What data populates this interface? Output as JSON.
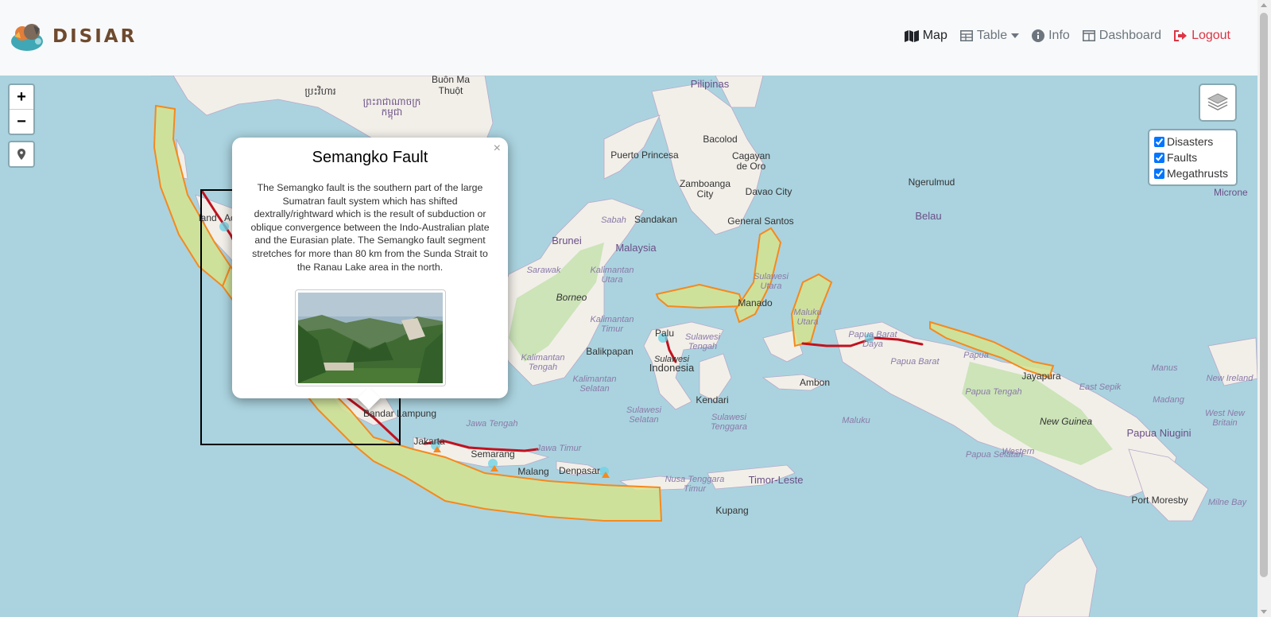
{
  "brand": {
    "name": "DISIAR"
  },
  "nav": {
    "map": "Map",
    "table": "Table",
    "info": "Info",
    "dashboard": "Dashboard",
    "logout": "Logout"
  },
  "map_controls": {
    "zoom_in": "+",
    "zoom_out": "−"
  },
  "layers": {
    "disasters": "Disasters",
    "faults": "Faults",
    "megathrusts": "Megathrusts"
  },
  "popup": {
    "close": "×",
    "title": "Semangko Fault",
    "description": "The Semangko fault is the southern part of the large Sumatran fault system which has shifted dextrally/rightward which is the result of subduction or oblique convergence between the Indo-Australian plate and the Eurasian plate. The Semangko fault segment stretches for more than 80 km from the Sunda Strait to the Ranau Lake area in the north."
  },
  "map_labels": {
    "buon_ma_thuot_1": "Buôn Ma",
    "buon_ma_thuot_2": "Thuột",
    "pilipinas": "Pilipinas",
    "preah_vihear": "ប្រះវិហារ",
    "kampuchea_1": "ព្រះរាជាណាចក្រ",
    "kampuchea_2": "កម្ពុជា",
    "puerto_princesa": "Puerto Princesa",
    "bacolod": "Bacolod",
    "cagayan_1": "Cagayan",
    "cagayan_2": "de Oro",
    "zamboanga_1": "Zamboanga",
    "zamboanga_2": "City",
    "davao": "Davao City",
    "ngerulmud": "Ngerulmud",
    "micronesia": "Microne",
    "land": "land",
    "ac": "Ac",
    "sabah": "Sabah",
    "sandakan": "Sandakan",
    "general_santos": "General Santos",
    "belau": "Belau",
    "brunei": "Brunei",
    "malaysia": "Malaysia",
    "sarawak": "Sarawak",
    "kalimantan_utara_1": "Kalimantan",
    "kalimantan_utara_2": "Utara",
    "sulawesi_utara_1": "Sulawesi",
    "sulawesi_utara_2": "Utara",
    "manado": "Manado",
    "maluku_utara_1": "Maluku",
    "maluku_utara_2": "Utara",
    "borneo": "Borneo",
    "kalimantan_timur_1": "Kalimantan",
    "kalimantan_timur_2": "Timur",
    "palu": "Palu",
    "sulawesi_tengah_1": "Sulawesi",
    "sulawesi_tengah_2": "Tengah",
    "papua_barat_daya_1": "Papua Barat",
    "papua_barat_daya_2": "Daya",
    "papua_barat": "Papua Barat",
    "papua": "Papua",
    "jayapura": "Jayapura",
    "manus": "Manus",
    "new_ireland_1": "New Ireland",
    "balikpapan": "Balikpapan",
    "sulawesi_label_1": "Sulawesi",
    "indonesia": "Indonesia",
    "ambon": "Ambon",
    "kalimantan_tengah_1": "Kalimantan",
    "kalimantan_tengah_2": "Tengah",
    "kalimantan_selatan_1": "Kalimantan",
    "kalimantan_selatan_2": "Selatan",
    "papua_tengah": "Papua Tengah",
    "east_sepik": "East Sepik",
    "madang": "Madang",
    "west_new_britain_1": "West New",
    "west_new_britain_2": "Britain",
    "kendari": "Kendari",
    "maluku": "Maluku",
    "new_guinea": "New Guinea",
    "papua_niugini": "Papua Niugini",
    "bandar_lampung": "Bandar Lampung",
    "sulawesi_selatan_1": "Sulawesi",
    "sulawesi_selatan_2": "Selatan",
    "sulawesi_tenggara_1": "Sulawesi",
    "sulawesi_tenggara_2": "Tenggara",
    "jawa_tengah": "Jawa Tengah",
    "jakarta": "Jakarta",
    "jawa_timur": "Jawa Timur",
    "semarang": "Semarang",
    "western": "Western",
    "papua_selatan": "Papua Selatan",
    "malang": "Malang",
    "denpasar": "Denpasar",
    "ntt_1": "Nusa Tenggara",
    "ntt_2": "Timur",
    "timor_leste": "Timor-Leste",
    "port_moresby": "Port Moresby",
    "milne_bay": "Milne Bay",
    "kupang": "Kupang"
  },
  "colors": {
    "water": "#aad3df",
    "land": "#f2efe9",
    "forest": "#c8e2b2",
    "megathrust_fill": "#d5e38f",
    "megathrust_stroke": "#f5891f",
    "fault": "#c1121f",
    "logout": "#dc3545"
  }
}
